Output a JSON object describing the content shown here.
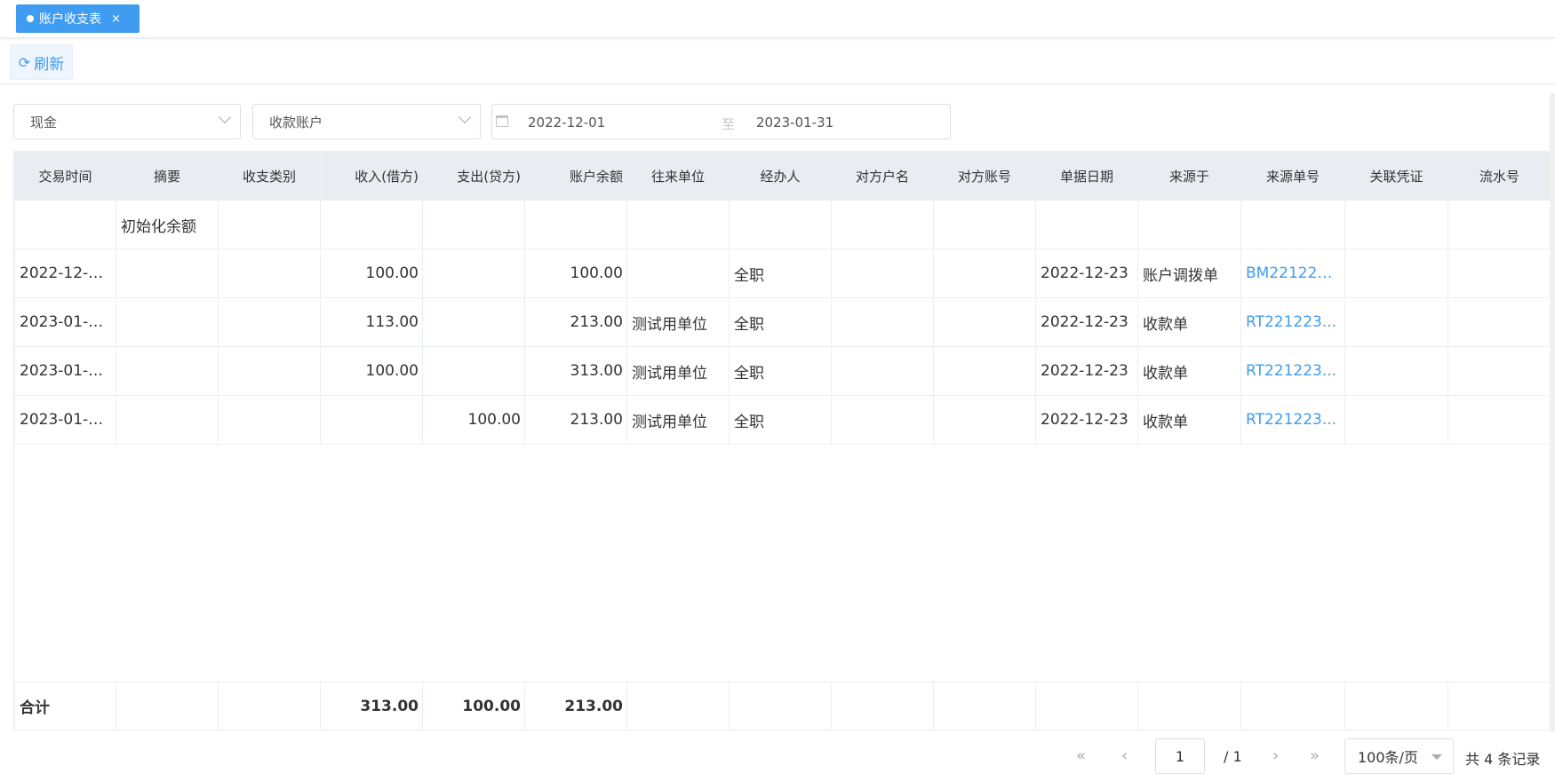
{
  "tabs": [
    {
      "label": "账户收支表",
      "close": "×"
    }
  ],
  "toolbar": {
    "refresh_label": "刷新"
  },
  "filters": {
    "account_type": "现金",
    "account": "收款账户",
    "date_start": "2022-12-01",
    "date_sep": "至",
    "date_end": "2023-01-31"
  },
  "table": {
    "columns": [
      "交易时间",
      "摘要",
      "收支类别",
      "收入(借方)",
      "支出(贷方)",
      "账户余额",
      "往来单位",
      "经办人",
      "对方户名",
      "对方账号",
      "单据日期",
      "来源于",
      "来源单号",
      "关联凭证",
      "流水号"
    ],
    "rows": [
      [
        "",
        "初始化余额",
        "",
        "",
        "",
        "",
        "",
        "",
        "",
        "",
        "",
        "",
        "",
        "",
        ""
      ],
      [
        "2022-12-2...",
        "",
        "",
        "100.00",
        "",
        "100.00",
        "",
        "全职",
        "",
        "",
        "2022-12-23",
        "账户调拨单",
        "BM221223...",
        "",
        ""
      ],
      [
        "2023-01-0...",
        "",
        "",
        "113.00",
        "",
        "213.00",
        "测试用单位",
        "全职",
        "",
        "",
        "2022-12-23",
        "收款单",
        "RT221223...",
        "",
        ""
      ],
      [
        "2023-01-0...",
        "",
        "",
        "100.00",
        "",
        "313.00",
        "测试用单位",
        "全职",
        "",
        "",
        "2022-12-23",
        "收款单",
        "RT221223...",
        "",
        ""
      ],
      [
        "2023-01-0...",
        "",
        "",
        "",
        "100.00",
        "213.00",
        "测试用单位",
        "全职",
        "",
        "",
        "2022-12-23",
        "收款单",
        "RT221223...",
        "",
        ""
      ]
    ],
    "footer": [
      "合计",
      "",
      "",
      "313.00",
      "100.00",
      "213.00",
      "",
      "",
      "",
      "",
      "",
      "",
      "",
      "",
      ""
    ]
  },
  "pager": {
    "current_page": "1",
    "total_pages": "/ 1",
    "page_size": "100条/页",
    "record_count": "共 4 条记录"
  },
  "colors": {
    "accent": "#3f9cf1",
    "header_bg": "#e9ecf1",
    "border": "#ebeef5"
  }
}
